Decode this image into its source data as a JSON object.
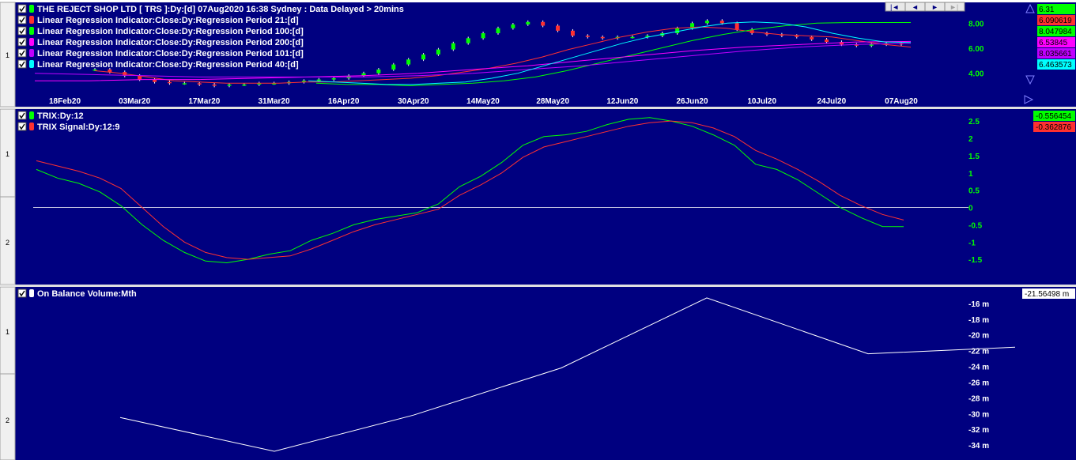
{
  "colors": {
    "background": "#000080",
    "grid_line": "#ffffff",
    "axis_label": "#ffffff",
    "tick_label_right": "#00ff00",
    "up_candle": "#00ff00",
    "down_candle": "#ff3030",
    "lr21": "#ff3030",
    "lr100": "#00ff00",
    "lr200": "#ff00ff",
    "lr101": "#c000ff",
    "lr40": "#00ffff",
    "trix": "#00ff00",
    "trix_signal": "#ff3030",
    "obv": "#ffffff"
  },
  "nav": {
    "first_label": "|◄",
    "prev_label": "◄",
    "next_label": "►",
    "last_label": "►|"
  },
  "price_pane": {
    "header_title": "THE REJECT SHOP LTD [ TRS ]:Dy:[d]  07Aug2020 16:38 Sydney : Data Delayed > 20mins",
    "left_markers": [
      "1"
    ],
    "legend": [
      {
        "label": "Linear Regression Indicator:Close:Dy:Regression Period 21:[d]",
        "color": "#ff3030"
      },
      {
        "label": "Linear Regression Indicator:Close:Dy:Regression Period 100:[d]",
        "color": "#00ff00"
      },
      {
        "label": "Linear Regression Indicator:Close:Dy:Regression Period 200:[d]",
        "color": "#ff00ff"
      },
      {
        "label": "Linear Regression Indicator:Close:Dy:Regression Period 101:[d]",
        "color": "#c000ff"
      },
      {
        "label": "Linear Regression Indicator:Close:Dy:Regression Period 40:[d]",
        "color": "#00ffff"
      }
    ],
    "value_badges": [
      {
        "value": "6.31",
        "bg": "#00ff00"
      },
      {
        "value": "6.090619",
        "bg": "#ff3030"
      },
      {
        "value": "8.047984",
        "bg": "#00ff00"
      },
      {
        "value": "6.53845",
        "bg": "#ff00ff"
      },
      {
        "value": "8.035661",
        "bg": "#c000ff"
      },
      {
        "value": "6.463573",
        "bg": "#00ffff"
      }
    ]
  },
  "trix_pane": {
    "left_markers": [
      "1",
      "2"
    ],
    "legend": [
      {
        "label": "TRIX:Dy:12",
        "color": "#00ff00"
      },
      {
        "label": "TRIX Signal:Dy:12:9",
        "color": "#ff3030"
      }
    ],
    "value_badges": [
      {
        "value": "-0.556454",
        "bg": "#00ff00"
      },
      {
        "value": "-0.362876",
        "bg": "#ff3030"
      }
    ]
  },
  "obv_pane": {
    "left_markers": [
      "1",
      "2"
    ],
    "legend": [
      {
        "label": "On Balance Volume:Mth",
        "color": "#ffffff"
      }
    ],
    "value_badges": [
      {
        "value": "-21.56498 m",
        "bg": "#ffffff"
      }
    ]
  },
  "chart_data": [
    {
      "type": "line",
      "title": "THE REJECT SHOP LTD [ TRS ]:Dy:[d]",
      "x_tick_labels": [
        "18Feb20",
        "03Mar20",
        "17Mar20",
        "31Mar20",
        "16Apr20",
        "30Apr20",
        "14May20",
        "28May20",
        "12Jun20",
        "26Jun20",
        "10Jul20",
        "24Jul20",
        "07Aug20"
      ],
      "y_ticks": [
        4.0,
        6.0,
        8.0
      ],
      "y_tick_labels": [
        "4.00",
        "6.00",
        "8.00"
      ],
      "ylim": [
        2.4,
        9.6
      ],
      "price_bars": {
        "style": "candlestick",
        "close": [
          4.3,
          4.1,
          3.8,
          3.5,
          3.3,
          3.2,
          3.2,
          3.1,
          3.0,
          3.1,
          3.1,
          3.2,
          3.2,
          3.3,
          3.4,
          3.5,
          3.6,
          3.8,
          4.0,
          4.3,
          4.7,
          5.1,
          5.5,
          5.9,
          6.4,
          6.8,
          7.2,
          7.6,
          7.9,
          8.1,
          7.8,
          7.4,
          7.0,
          6.9,
          6.8,
          6.9,
          6.9,
          7.0,
          7.2,
          7.6,
          8.0,
          8.2,
          8.0,
          7.5,
          7.2,
          7.1,
          7.0,
          6.9,
          6.7,
          6.5,
          6.3,
          6.2,
          6.3,
          6.4,
          6.31
        ]
      },
      "series": [
        {
          "name": "Linear Regression Indicator:Close:Dy:Regression Period 21:[d]",
          "values": [
            4.2,
            4.0,
            3.7,
            3.4,
            3.3,
            3.2,
            3.2,
            3.2,
            3.3,
            3.3,
            3.4,
            3.5,
            3.6,
            3.8,
            4.1,
            4.4,
            4.8,
            5.3,
            5.9,
            6.4,
            6.9,
            7.3,
            7.6,
            7.7,
            7.6,
            7.3,
            7.1,
            7.0,
            6.9,
            6.6,
            6.3,
            6.09
          ]
        },
        {
          "name": "Linear Regression Indicator:Close:Dy:Regression Period 100:[d]",
          "values": [
            3.2,
            3.1,
            3.1,
            3.0,
            3.1,
            3.2,
            3.4,
            3.7,
            4.2,
            4.8,
            5.4,
            6.0,
            6.6,
            7.1,
            7.5,
            7.8,
            8.0,
            8.05,
            8.05,
            8.05
          ]
        },
        {
          "name": "Linear Regression Indicator:Close:Dy:Regression Period 200:[d]",
          "values": [
            3.4,
            3.4,
            3.5,
            3.5,
            3.6,
            3.7,
            3.8,
            4.0,
            4.3,
            4.6,
            5.0,
            5.4,
            5.8,
            6.1,
            6.3,
            6.5,
            6.54
          ]
        },
        {
          "name": "Linear Regression Indicator:Close:Dy:Regression Period 101:[d]",
          "values": [
            4.0,
            3.9,
            3.8,
            3.7,
            3.7,
            3.7,
            3.7,
            3.8,
            4.0,
            4.3,
            4.6,
            5.0,
            5.4,
            5.8,
            6.1,
            6.3,
            6.4
          ]
        },
        {
          "name": "Linear Regression Indicator:Close:Dy:Regression Period 40:[d]",
          "values": [
            3.4,
            3.3,
            3.2,
            3.1,
            3.1,
            3.2,
            3.3,
            3.6,
            4.0,
            4.6,
            5.2,
            5.8,
            6.4,
            6.9,
            7.3,
            7.7,
            8.0,
            8.1,
            8.0,
            7.7,
            7.2,
            6.8,
            6.5,
            6.46
          ]
        }
      ]
    },
    {
      "type": "line",
      "title": "",
      "y_ticks": [
        -1.5,
        -1,
        -0.5,
        0,
        0.5,
        1,
        1.5,
        2,
        2.5
      ],
      "y_tick_labels": [
        "-1.5",
        "-1",
        "-0.5",
        "0",
        "0.5",
        "1",
        "1.5",
        "2",
        "2.5"
      ],
      "ylim": [
        -2.0,
        2.8
      ],
      "zero_line": 0,
      "series": [
        {
          "name": "TRIX:Dy:12",
          "values": [
            1.1,
            0.85,
            0.7,
            0.45,
            0.05,
            -0.5,
            -0.95,
            -1.3,
            -1.55,
            -1.6,
            -1.5,
            -1.35,
            -1.25,
            -0.95,
            -0.75,
            -0.5,
            -0.35,
            -0.25,
            -0.15,
            0.1,
            0.6,
            0.9,
            1.3,
            1.8,
            2.05,
            2.1,
            2.2,
            2.4,
            2.55,
            2.6,
            2.5,
            2.35,
            2.1,
            1.8,
            1.25,
            1.1,
            0.8,
            0.4,
            0.0,
            -0.3,
            -0.55,
            -0.556
          ]
        },
        {
          "name": "TRIX Signal:Dy:12:9",
          "values": [
            1.35,
            1.2,
            1.05,
            0.85,
            0.55,
            0.0,
            -0.55,
            -1.0,
            -1.3,
            -1.45,
            -1.5,
            -1.45,
            -1.4,
            -1.2,
            -0.95,
            -0.7,
            -0.5,
            -0.35,
            -0.2,
            -0.05,
            0.35,
            0.65,
            1.0,
            1.45,
            1.75,
            1.9,
            2.05,
            2.2,
            2.35,
            2.45,
            2.5,
            2.45,
            2.3,
            2.05,
            1.65,
            1.4,
            1.1,
            0.75,
            0.35,
            0.05,
            -0.2,
            -0.363
          ]
        }
      ]
    },
    {
      "type": "line",
      "title": "",
      "y_ticks": [
        -34,
        -32,
        -30,
        -28,
        -26,
        -24,
        -22,
        -20,
        -18,
        -16
      ],
      "y_tick_labels": [
        "-34 m",
        "-32 m",
        "-30 m",
        "-28 m",
        "-26 m",
        "-24 m",
        "-22 m",
        "-20 m",
        "-18 m",
        "-16 m"
      ],
      "ylim": [
        -35.5,
        -14.2
      ],
      "series": [
        {
          "name": "On Balance Volume:Mth",
          "values": [
            -30.5,
            -34.8,
            -30.2,
            -24.2,
            -15.3,
            -22.4,
            -21.56
          ]
        }
      ]
    }
  ]
}
